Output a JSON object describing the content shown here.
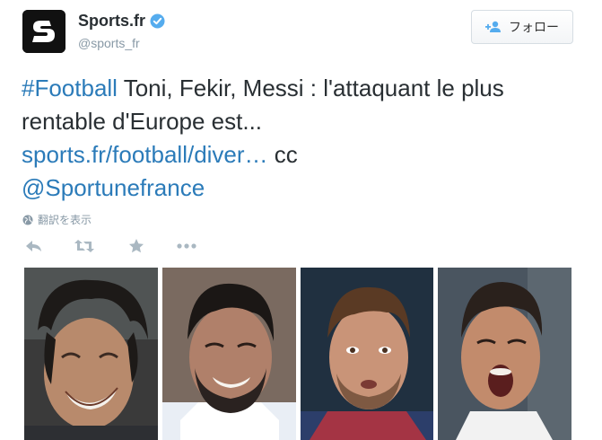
{
  "account": {
    "display_name": "Sports.fr",
    "handle": "@sports_fr",
    "avatar_icon": "sports-fr-logo-icon",
    "verified_icon": "verified-badge-icon"
  },
  "follow_button": {
    "label": "フォロー",
    "icon": "add-user-icon"
  },
  "tweet": {
    "hashtag": "#Football",
    "text_line_1": " Toni, Fekir, Messi : l'attaquant le plus rentable d'Europe est...",
    "link": "sports.fr/football/diver…",
    "text_after_link": " cc",
    "mention": "@Sportunefrance"
  },
  "translate": {
    "label": "翻訳を表示",
    "icon": "globe-icon"
  },
  "actions": [
    {
      "name": "reply",
      "icon": "reply-icon"
    },
    {
      "name": "retweet",
      "icon": "retweet-icon"
    },
    {
      "name": "favorite",
      "icon": "star-icon"
    },
    {
      "name": "more",
      "icon": "more-icon"
    }
  ],
  "media": {
    "photos": [
      "player-photo-1",
      "player-photo-2",
      "player-photo-3",
      "player-photo-4"
    ]
  },
  "colors": {
    "link": "#2b7bb9",
    "text": "#292f33",
    "muted": "#8899a6",
    "verified": "#55acee"
  }
}
